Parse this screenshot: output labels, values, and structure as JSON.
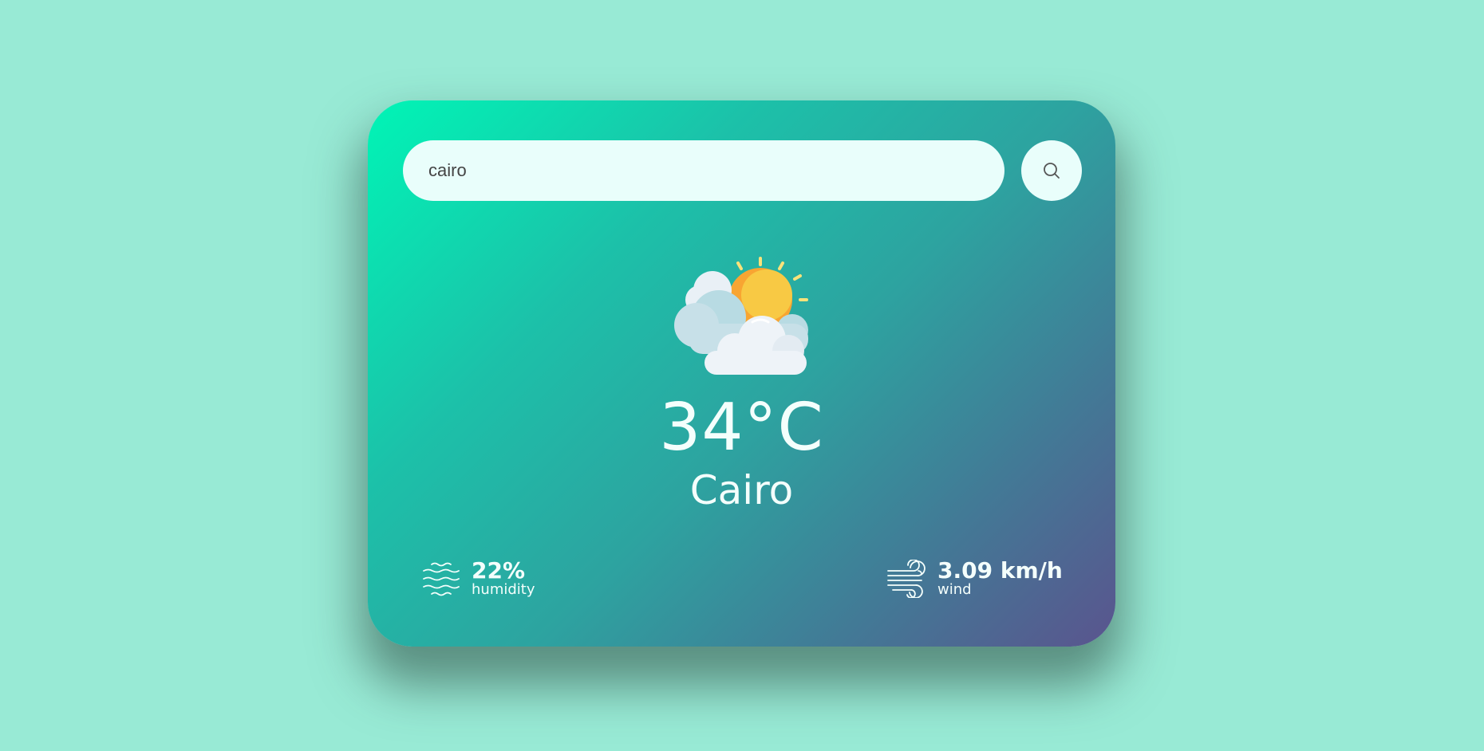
{
  "search": {
    "value": "cairo",
    "button_icon": "search-icon"
  },
  "weather": {
    "icon": "partly-cloudy-icon",
    "temperature": "34°C",
    "city": "Cairo"
  },
  "humidity": {
    "icon": "humidity-waves-icon",
    "value": "22%",
    "label": "humidity"
  },
  "wind": {
    "icon": "wind-icon",
    "value": "3.09 km/h",
    "label": "wind"
  },
  "colors": {
    "background": "#98ead5",
    "gradient_start": "#00f5b6",
    "gradient_end": "#5a548e",
    "text": "#f4fffc",
    "input_bg": "#e9fefb"
  }
}
